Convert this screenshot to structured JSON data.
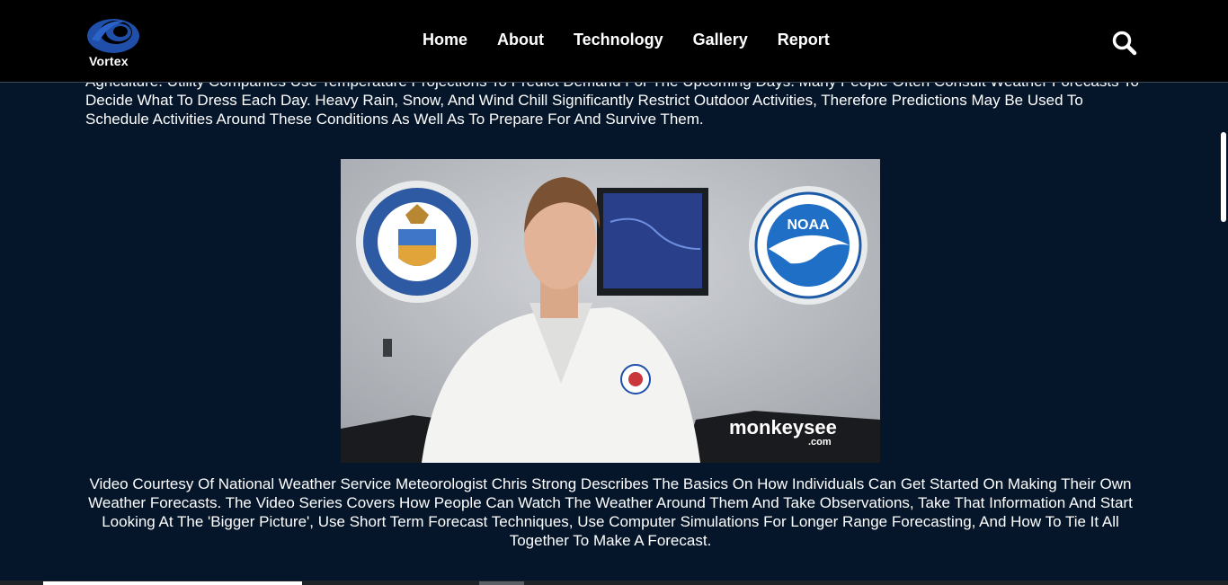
{
  "header": {
    "logo_text": "Vortex",
    "nav": [
      "Home",
      "About",
      "Technology",
      "Gallery",
      "Report"
    ]
  },
  "content": {
    "intro_text": "Agriculture. Utility Companies Use Temperature Projections To Predict Demand For The Upcoming Days. Many People Often Consult Weather Forecasts To Decide What To Dress Each Day. Heavy Rain, Snow, And Wind Chill Significantly Restrict Outdoor Activities, Therefore Predictions May Be Used To Schedule Activities Around These Conditions As Well As To Prepare For And Survive Them.",
    "video": {
      "left_seal_text": "DEPARTMENT OF COMMERCE · UNITED STATES OF AMERICA",
      "right_seal_text": "NOAA",
      "watermark": "monkeysee",
      "watermark_domain": ".com"
    },
    "caption": "Video Courtesy Of National Weather Service Meteorologist Chris Strong Describes The Basics On How Individuals Can Get Started On Making Their Own Weather Forecasts. The Video Series Covers How People Can Watch The Weather Around Them And Take Observations, Take That Information And Start Looking At The 'Bigger Picture', Use Short Term Forecast Techniques, Use Computer Simulations For Longer Range Forecasting, And How To Tie It All Together To Make A Forecast."
  },
  "colors": {
    "background": "#05162b",
    "header": "#000000",
    "logo_blue": "#1f4fa8",
    "text": "#ffffff"
  },
  "icons": {
    "search": "search-icon",
    "logo": "vortex-logo"
  }
}
